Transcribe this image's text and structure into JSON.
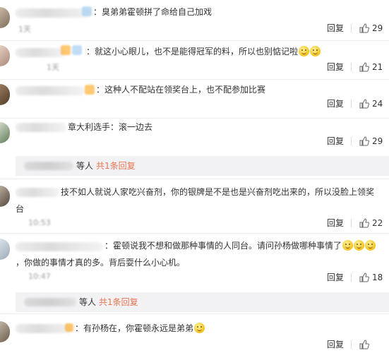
{
  "comments": [
    {
      "text": "：臭弟弟霍顿拼了命给自己加戏",
      "time": "1天",
      "reply": "回复",
      "likes": "29",
      "thumb_icon": "thumbs-up-icon"
    },
    {
      "text": "：就这小心眼儿，也不是能得冠军的料，所以也别惦记啦",
      "time": "1天",
      "reply": "回复",
      "likes": "21",
      "emoji_icons": [
        "grin-emoji-icon",
        "grin-emoji-icon"
      ]
    },
    {
      "text": "：这种人不配站在领奖台上，也不配参加比赛",
      "time": "",
      "reply": "回复",
      "likes": "24"
    },
    {
      "text": "章大利选手：滚一边去",
      "time": "",
      "reply": "回复",
      "likes": "29",
      "sub": {
        "people": "等人",
        "link": "共1条回复"
      }
    },
    {
      "text": "技不如人就说人家吃兴奋剂，你的银牌是不是也是兴奋剂吃出来的，所以没脸上领奖",
      "text2": "台",
      "time": "10:53",
      "reply": "回复",
      "likes": "22"
    },
    {
      "text": "：霍顿说我不想和做那种事情的人同台。请问孙杨做哪种事情了",
      "text2": "，你做的事情才真的多。背后耍什么小心机。",
      "time": "10:47",
      "reply": "回复",
      "likes": "18",
      "emoji_icons": [
        "smile-emoji-icon",
        "smile-emoji-icon",
        "smile-emoji-icon"
      ],
      "sub": {
        "people": "等人",
        "link": "共1条回复"
      }
    },
    {
      "text": "：有孙杨在，你霍顿永远是弟弟",
      "time": "",
      "reply": "回复",
      "likes": "",
      "emoji_icons": [
        "smile-emoji-icon"
      ]
    }
  ]
}
